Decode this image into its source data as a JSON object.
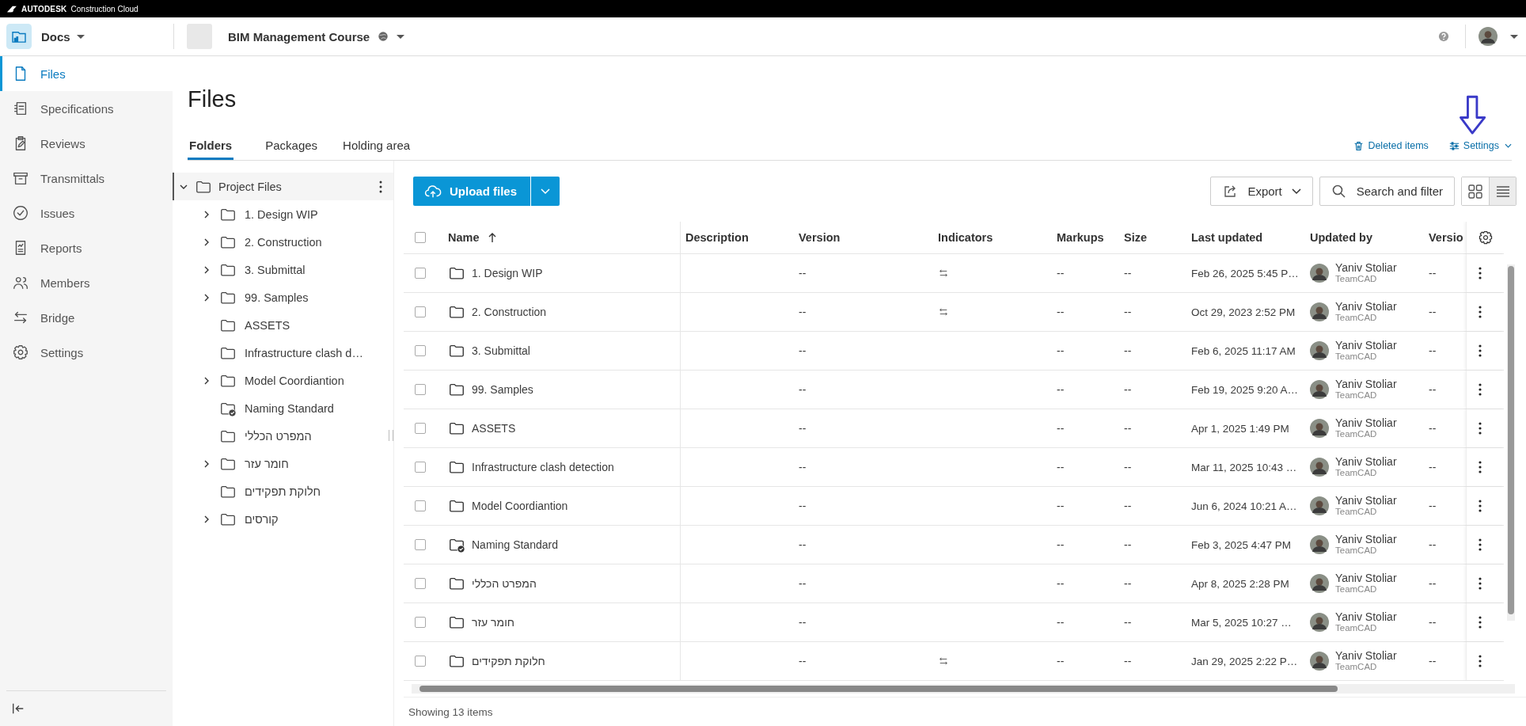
{
  "brand": {
    "name": "AUTODESK",
    "product": "Construction Cloud"
  },
  "header": {
    "module": "Docs",
    "project": "BIM Management Course"
  },
  "sidebar": {
    "items": [
      {
        "label": "Files",
        "kind": "file",
        "selected": true
      },
      {
        "label": "Specifications",
        "kind": "list",
        "selected": false
      },
      {
        "label": "Reviews",
        "kind": "clipboard",
        "selected": false
      },
      {
        "label": "Transmittals",
        "kind": "archive",
        "selected": false
      },
      {
        "label": "Issues",
        "kind": "check",
        "selected": false
      },
      {
        "label": "Reports",
        "kind": "report",
        "selected": false
      },
      {
        "label": "Members",
        "kind": "people",
        "selected": false
      },
      {
        "label": "Bridge",
        "kind": "arrows",
        "selected": false
      },
      {
        "label": "Settings",
        "kind": "gear",
        "selected": false
      }
    ]
  },
  "page": {
    "title": "Files"
  },
  "tabs": [
    {
      "label": "Folders",
      "selected": true
    },
    {
      "label": "Packages",
      "selected": false
    },
    {
      "label": "Holding area",
      "selected": false
    }
  ],
  "actions": {
    "deleted": "Deleted items",
    "settings": "Settings"
  },
  "tree": {
    "label": "Project Files",
    "expanded": true,
    "children": [
      {
        "label": "1. Design WIP",
        "kind": "folder",
        "expandable": true
      },
      {
        "label": "2. Construction",
        "kind": "folder",
        "expandable": true
      },
      {
        "label": "3. Submittal",
        "kind": "folder",
        "expandable": true
      },
      {
        "label": "99. Samples",
        "kind": "folder",
        "expandable": true
      },
      {
        "label": "ASSETS",
        "kind": "folder",
        "expandable": false
      },
      {
        "label": "Infrastructure clash d…",
        "kind": "folder",
        "expandable": false
      },
      {
        "label": "Model Coordiantion",
        "kind": "folder",
        "expandable": true
      },
      {
        "label": "Naming Standard",
        "kind": "folder-check",
        "expandable": false
      },
      {
        "label": "המפרט הכללי",
        "kind": "folder",
        "expandable": false
      },
      {
        "label": "חומר עזר",
        "kind": "folder",
        "expandable": true
      },
      {
        "label": "חלוקת תפקידים",
        "kind": "folder",
        "expandable": false
      },
      {
        "label": "קורסים",
        "kind": "folder",
        "expandable": true
      }
    ]
  },
  "toolbar": {
    "upload": "Upload files",
    "export": "Export",
    "search": "Search and filter",
    "views": [
      {
        "kind": "grid",
        "selected": false
      },
      {
        "kind": "list",
        "selected": true
      }
    ]
  },
  "table": {
    "all_checked": false,
    "columns": [
      {
        "label": "Name",
        "sorted": true
      },
      {
        "label": "Description",
        "sorted": false
      },
      {
        "label": "Version",
        "sorted": false
      },
      {
        "label": "Indicators",
        "sorted": false
      },
      {
        "label": "Markups",
        "sorted": false
      },
      {
        "label": "Size",
        "sorted": false
      },
      {
        "label": "Last updated",
        "sorted": false
      },
      {
        "label": "Updated by",
        "sorted": false
      },
      {
        "label": "Versio",
        "sorted": false
      }
    ],
    "rows": [
      {
        "name": "1. Design WIP",
        "kind": "folder",
        "checked": false,
        "version": "--",
        "synced": true,
        "markups": "--",
        "size": "--",
        "updated": "Feb 26, 2025 5:45 P…",
        "by": "Yaniv Stoliar",
        "company": "TeamCAD",
        "version_2": "--"
      },
      {
        "name": "2. Construction",
        "kind": "folder",
        "checked": false,
        "version": "--",
        "synced": true,
        "markups": "--",
        "size": "--",
        "updated": "Oct 29, 2023 2:52 PM",
        "by": "Yaniv Stoliar",
        "company": "TeamCAD",
        "version_2": "--"
      },
      {
        "name": "3. Submittal",
        "kind": "folder",
        "checked": false,
        "version": "--",
        "synced": false,
        "markups": "--",
        "size": "--",
        "updated": "Feb 6, 2025 11:17 AM",
        "by": "Yaniv Stoliar",
        "company": "TeamCAD",
        "version_2": "--"
      },
      {
        "name": "99. Samples",
        "kind": "folder",
        "checked": false,
        "version": "--",
        "synced": false,
        "markups": "--",
        "size": "--",
        "updated": "Feb 19, 2025 9:20 A…",
        "by": "Yaniv Stoliar",
        "company": "TeamCAD",
        "version_2": "--"
      },
      {
        "name": "ASSETS",
        "kind": "folder",
        "checked": false,
        "version": "--",
        "synced": false,
        "markups": "--",
        "size": "--",
        "updated": "Apr 1, 2025 1:49 PM",
        "by": "Yaniv Stoliar",
        "company": "TeamCAD",
        "version_2": "--"
      },
      {
        "name": "Infrastructure clash detection",
        "kind": "folder",
        "checked": false,
        "version": "--",
        "synced": false,
        "markups": "--",
        "size": "--",
        "updated": "Mar 11, 2025 10:43 …",
        "by": "Yaniv Stoliar",
        "company": "TeamCAD",
        "version_2": "--"
      },
      {
        "name": "Model Coordiantion",
        "kind": "folder",
        "checked": false,
        "version": "--",
        "synced": false,
        "markups": "--",
        "size": "--",
        "updated": "Jun 6, 2024 10:21 A…",
        "by": "Yaniv Stoliar",
        "company": "TeamCAD",
        "version_2": "--"
      },
      {
        "name": "Naming Standard",
        "kind": "folder-check",
        "checked": false,
        "version": "--",
        "synced": false,
        "markups": "--",
        "size": "--",
        "updated": "Feb 3, 2025 4:47 PM",
        "by": "Yaniv Stoliar",
        "company": "TeamCAD",
        "version_2": "--"
      },
      {
        "name": "המפרט הכללי",
        "kind": "folder",
        "checked": false,
        "version": "--",
        "synced": false,
        "markups": "--",
        "size": "--",
        "updated": "Apr 8, 2025 2:28 PM",
        "by": "Yaniv Stoliar",
        "company": "TeamCAD",
        "version_2": "--"
      },
      {
        "name": "חומר עזר",
        "kind": "folder",
        "checked": false,
        "version": "--",
        "synced": false,
        "markups": "--",
        "size": "--",
        "updated": "Mar 5, 2025 10:27 …",
        "by": "Yaniv Stoliar",
        "company": "TeamCAD",
        "version_2": "--"
      },
      {
        "name": "חלוקת תפקידים",
        "kind": "folder",
        "checked": false,
        "version": "--",
        "synced": true,
        "markups": "--",
        "size": "--",
        "updated": "Jan 29, 2025 2:22 P…",
        "by": "Yaniv Stoliar",
        "company": "TeamCAD",
        "version_2": "--"
      }
    ]
  },
  "footer": "Showing 13 items"
}
